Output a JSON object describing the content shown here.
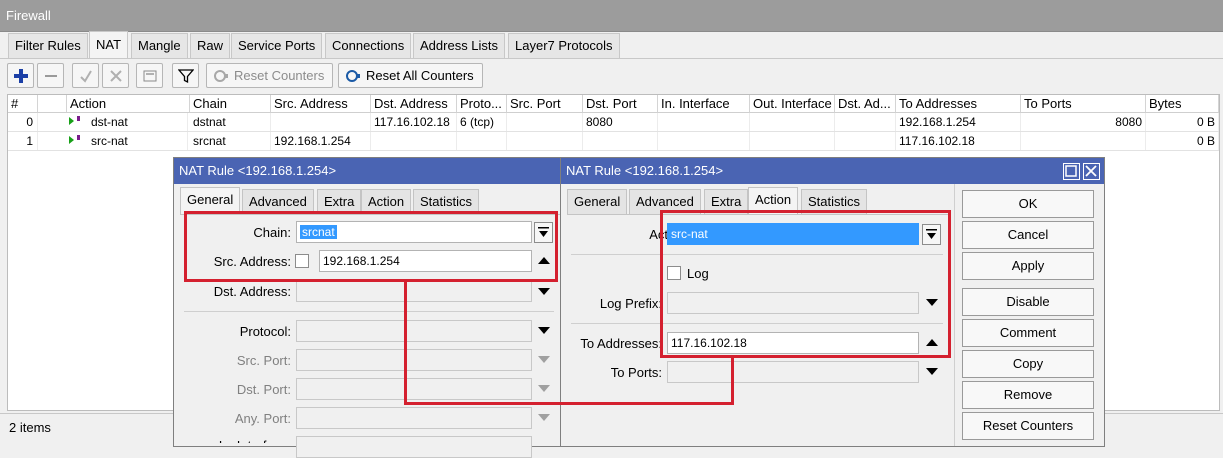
{
  "window": {
    "title": "Firewall"
  },
  "tabs": [
    "Filter Rules",
    "NAT",
    "Mangle",
    "Raw",
    "Service Ports",
    "Connections",
    "Address Lists",
    "Layer7 Protocols"
  ],
  "toolbar": {
    "reset_counters": "Reset Counters",
    "reset_all_counters": "Reset All Counters"
  },
  "table": {
    "columns": [
      "#",
      "Action",
      "Chain",
      "Src. Address",
      "Dst. Address",
      "Proto...",
      "Src. Port",
      "Dst. Port",
      "In. Interface",
      "Out. Interface",
      "Dst. Ad...",
      "To Addresses",
      "To Ports",
      "Bytes"
    ],
    "rows": [
      {
        "num": "0",
        "action": "dst-nat",
        "chain": "dstnat",
        "src_address": "",
        "dst_address": "117.16.102.18",
        "protocol": "6 (tcp)",
        "src_port": "",
        "dst_port": "8080",
        "in_interface": "",
        "out_interface": "",
        "dst_ad": "",
        "to_addresses": "192.168.1.254",
        "to_ports": "8080",
        "bytes": "0 B"
      },
      {
        "num": "1",
        "action": "src-nat",
        "chain": "srcnat",
        "src_address": "192.168.1.254",
        "dst_address": "",
        "protocol": "",
        "src_port": "",
        "dst_port": "",
        "in_interface": "",
        "out_interface": "",
        "dst_ad": "",
        "to_addresses": "117.16.102.18",
        "to_ports": "",
        "bytes": "0 B"
      }
    ]
  },
  "status": {
    "items": "2 items"
  },
  "dialog1": {
    "title": "NAT Rule <192.168.1.254>",
    "tabs": [
      "General",
      "Advanced",
      "Extra",
      "Action",
      "Statistics"
    ],
    "chain_label": "Chain:",
    "chain_value": "srcnat",
    "src_address_label": "Src. Address:",
    "src_address_value": "192.168.1.254",
    "dst_address_label": "Dst. Address:",
    "protocol_label": "Protocol:",
    "src_port_label": "Src. Port:",
    "dst_port_label": "Dst. Port:",
    "any_port_label": "Any. Port:",
    "in_interface_label_partial": "In. Interface:"
  },
  "dialog2": {
    "title": "NAT Rule <192.168.1.254>",
    "tabs": [
      "General",
      "Advanced",
      "Extra",
      "Action",
      "Statistics"
    ],
    "action_label": "Action:",
    "action_value": "src-nat",
    "log_label": "Log",
    "log_prefix_label": "Log Prefix:",
    "to_addresses_label": "To Addresses:",
    "to_addresses_value": "117.16.102.18",
    "to_ports_label": "To Ports:",
    "buttons": [
      "OK",
      "Cancel",
      "Apply",
      "Disable",
      "Comment",
      "Copy",
      "Remove",
      "Reset Counters"
    ]
  },
  "colors": {
    "dialog_title_bar": "#4a64b3",
    "highlight": "#d4202f",
    "selection": "#3399ff"
  }
}
